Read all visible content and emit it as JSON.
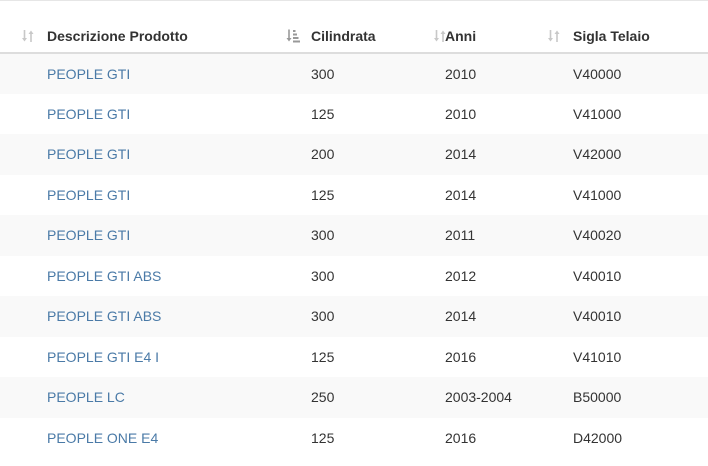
{
  "table": {
    "columns": [
      {
        "label": "Descrizione Prodotto",
        "sort": "unsorted",
        "sort_icon": "sort-both-icon"
      },
      {
        "label": "Cilindrata",
        "sort": "ascending",
        "sort_icon": "sort-amount-asc-icon"
      },
      {
        "label": "Anni",
        "sort": "unsorted",
        "sort_icon": "sort-both-icon"
      },
      {
        "label": "Sigla Telaio",
        "sort": "unsorted",
        "sort_icon": "sort-both-icon"
      }
    ],
    "rows": [
      {
        "descrizione": "PEOPLE GTI",
        "cilindrata": "300",
        "anni": "2010",
        "sigla": "V40000"
      },
      {
        "descrizione": "PEOPLE GTI",
        "cilindrata": "125",
        "anni": "2010",
        "sigla": "V41000"
      },
      {
        "descrizione": "PEOPLE GTI",
        "cilindrata": "200",
        "anni": "2014",
        "sigla": "V42000"
      },
      {
        "descrizione": "PEOPLE GTI",
        "cilindrata": "125",
        "anni": "2014",
        "sigla": "V41000"
      },
      {
        "descrizione": "PEOPLE GTI",
        "cilindrata": "300",
        "anni": "2011",
        "sigla": "V40020"
      },
      {
        "descrizione": "PEOPLE GTI ABS",
        "cilindrata": "300",
        "anni": "2012",
        "sigla": "V40010"
      },
      {
        "descrizione": "PEOPLE GTI ABS",
        "cilindrata": "300",
        "anni": "2014",
        "sigla": "V40010"
      },
      {
        "descrizione": "PEOPLE GTI E4 I",
        "cilindrata": "125",
        "anni": "2016",
        "sigla": "V41010"
      },
      {
        "descrizione": "PEOPLE LC",
        "cilindrata": "250",
        "anni": "2003-2004",
        "sigla": "B50000"
      },
      {
        "descrizione": "PEOPLE ONE E4",
        "cilindrata": "125",
        "anni": "2016",
        "sigla": "D42000"
      }
    ]
  },
  "colors": {
    "link": "#4a7aa7",
    "stripe": "#f9f9f9",
    "header_border": "#dddddd",
    "sort_icon_inactive": "#c8c8c8",
    "sort_icon_active": "#999999"
  }
}
